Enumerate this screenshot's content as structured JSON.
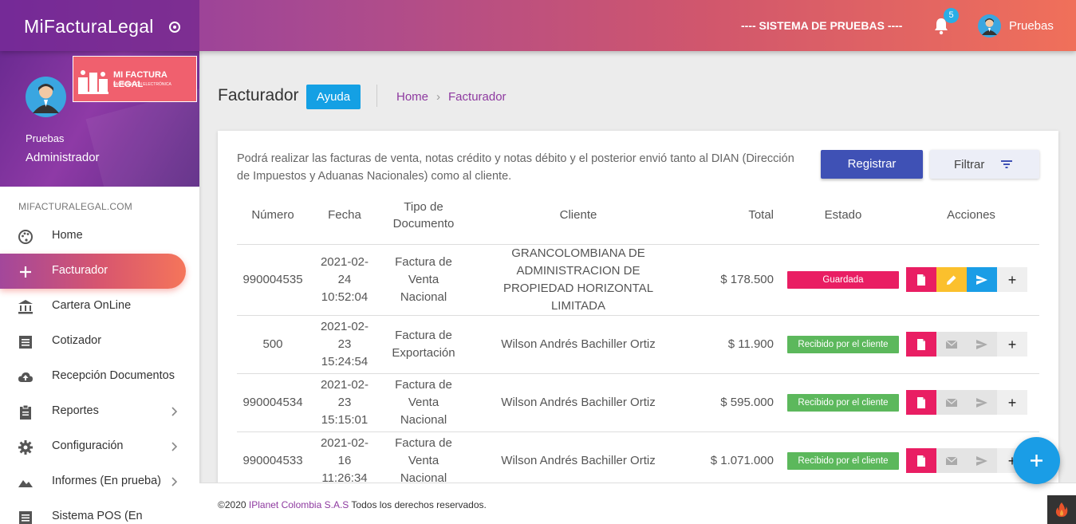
{
  "header": {
    "brand": "MiFacturaLegal",
    "system_label": "---- SISTEMA DE PRUEBAS ----",
    "notification_count": "5",
    "user": "Pruebas"
  },
  "sidebar": {
    "logo_title": "MI FACTURA LEGAL",
    "logo_subtitle": "FACTURACIÓN ELECTRÓNICA",
    "user_name": "Pruebas",
    "user_role": "Administrador",
    "section_header": "MIFACTURALEGAL.COM",
    "items": [
      {
        "label": "Home",
        "icon": "palette-icon"
      },
      {
        "label": "Facturador",
        "icon": "plus-icon",
        "active": true
      },
      {
        "label": "Cartera OnLine",
        "icon": "bank-icon"
      },
      {
        "label": "Cotizador",
        "icon": "list-icon"
      },
      {
        "label": "Recepción Documentos",
        "icon": "cloud-upload-icon"
      },
      {
        "label": "Reportes",
        "icon": "clipboard-icon"
      },
      {
        "label": "Configuración",
        "icon": "gear-icon"
      },
      {
        "label": "Informes (En prueba)",
        "icon": "terrain-icon"
      },
      {
        "label": "Sistema POS (En",
        "icon": "list-icon"
      }
    ]
  },
  "page": {
    "title": "Facturador",
    "help_label": "Ayuda",
    "breadcrumb": [
      "Home",
      "Facturador"
    ]
  },
  "card": {
    "intro": "Podrá realizar las facturas de venta, notas crédito y notas débito y el posterior envió tanto al DIAN (Dirección de Impuestos y Aduanas Nacionales) como al cliente.",
    "register_label": "Registrar",
    "filter_label": "Filtrar"
  },
  "table": {
    "columns": [
      "Número",
      "Fecha",
      "Tipo de Documento",
      "Cliente",
      "Total",
      "Estado",
      "Acciones"
    ],
    "rows": [
      {
        "numero": "990004535",
        "fecha": "2021-02-24 10:52:04",
        "tipo": "Factura de Venta Nacional",
        "cliente": "GRANCOLOMBIANA DE ADMINISTRACION DE PROPIEDAD HORIZONTAL LIMITADA",
        "total": "$ 178.500",
        "estado": "Guardada",
        "estado_color": "#e91e63"
      },
      {
        "numero": "500",
        "fecha": "2021-02-23 15:24:54",
        "tipo": "Factura de Exportación",
        "cliente": "Wilson Andrés Bachiller Ortiz",
        "total": "$ 11.900",
        "estado": "Recibido por el cliente",
        "estado_color": "#5cb85c"
      },
      {
        "numero": "990004534",
        "fecha": "2021-02-23 15:15:01",
        "tipo": "Factura de Venta Nacional",
        "cliente": "Wilson Andrés Bachiller Ortiz",
        "total": "$ 595.000",
        "estado": "Recibido por el cliente",
        "estado_color": "#5cb85c"
      },
      {
        "numero": "990004533",
        "fecha": "2021-02-16 11:26:34",
        "tipo": "Factura de Venta Nacional",
        "cliente": "Wilson Andrés Bachiller Ortiz",
        "total": "$ 1.071.000",
        "estado": "Recibido por el cliente",
        "estado_color": "#5cb85c"
      }
    ]
  },
  "footer": {
    "prefix": "©2020",
    "company": "IPlanet Colombia S.A.S",
    "suffix": "Todos los derechos reservados."
  }
}
